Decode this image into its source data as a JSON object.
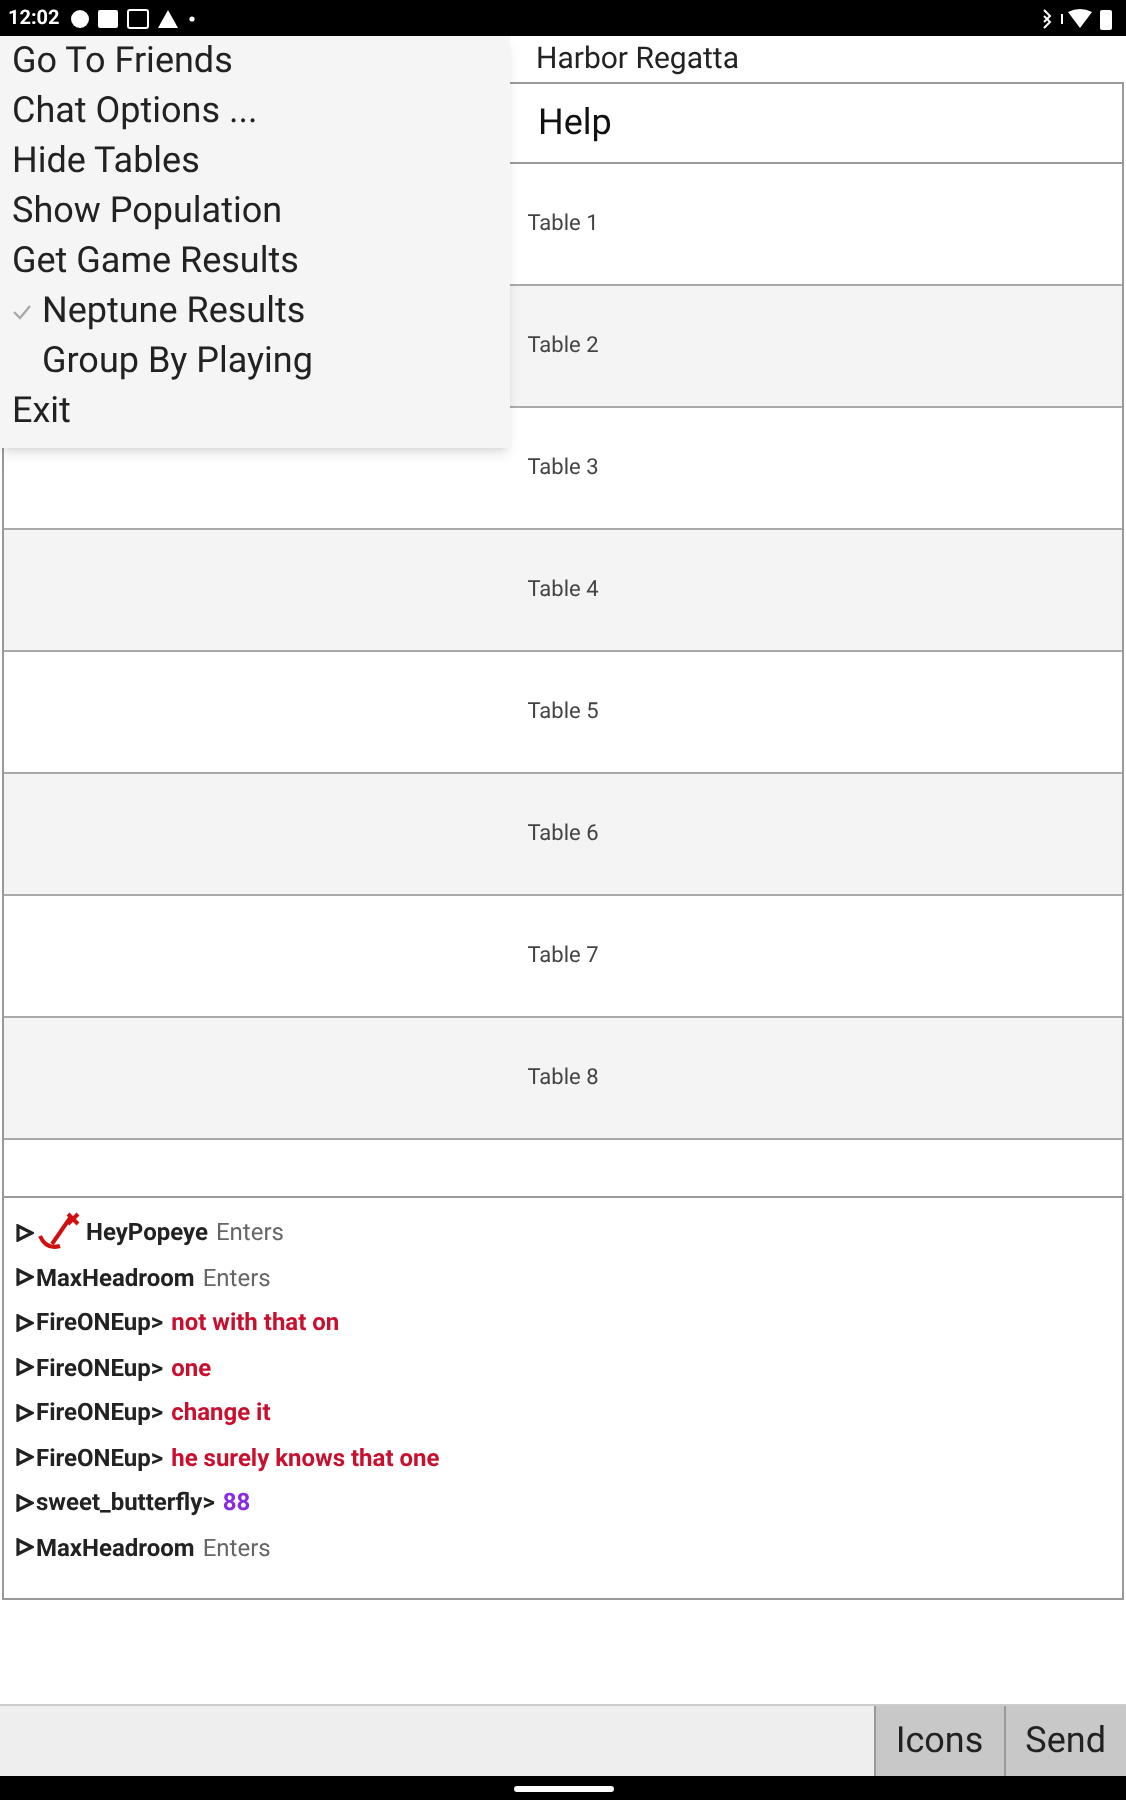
{
  "status_bar": {
    "time": "12:02"
  },
  "title": "Harbor Regatta",
  "help_bar": {
    "label": "Help"
  },
  "tables": [
    {
      "label": "Table 1"
    },
    {
      "label": "Table 2"
    },
    {
      "label": "Table 3"
    },
    {
      "label": "Table 4"
    },
    {
      "label": "Table 5"
    },
    {
      "label": "Table 6"
    },
    {
      "label": "Table 7"
    },
    {
      "label": "Table 8"
    }
  ],
  "chat": [
    {
      "kind": "enter",
      "user": "HeyPopeye",
      "badge": true,
      "text": "Enters"
    },
    {
      "kind": "enter",
      "user": "MaxHeadroom",
      "badge": false,
      "text": "Enters"
    },
    {
      "kind": "message",
      "user": "FireONEup>",
      "badge": false,
      "text": "not with that on",
      "color": "#c8102e"
    },
    {
      "kind": "message",
      "user": "FireONEup>",
      "badge": false,
      "text": "one",
      "color": "#c8102e"
    },
    {
      "kind": "message",
      "user": "FireONEup>",
      "badge": false,
      "text": "change it",
      "color": "#c8102e"
    },
    {
      "kind": "message",
      "user": "FireONEup>",
      "badge": false,
      "text": "he surely knows that one",
      "color": "#c8102e"
    },
    {
      "kind": "message",
      "user": "sweet_butterfly>",
      "badge": false,
      "text": "88",
      "color": "#8a2be2"
    },
    {
      "kind": "enter",
      "user": "MaxHeadroom",
      "badge": false,
      "text": "Enters"
    }
  ],
  "input_bar": {
    "buttons": [
      "Icons",
      "Send"
    ]
  },
  "menu": {
    "items": [
      {
        "kind": "plain",
        "label": "Go To Friends"
      },
      {
        "kind": "plain",
        "label": "Chat Options ..."
      },
      {
        "kind": "plain",
        "label": "Hide Tables"
      },
      {
        "kind": "plain",
        "label": "Show Population"
      },
      {
        "kind": "plain",
        "label": "Get Game Results"
      },
      {
        "kind": "check",
        "label": "Neptune Results",
        "checked": true
      },
      {
        "kind": "check",
        "label": "Group By Playing",
        "checked": false
      },
      {
        "kind": "plain",
        "label": "Exit"
      }
    ]
  }
}
